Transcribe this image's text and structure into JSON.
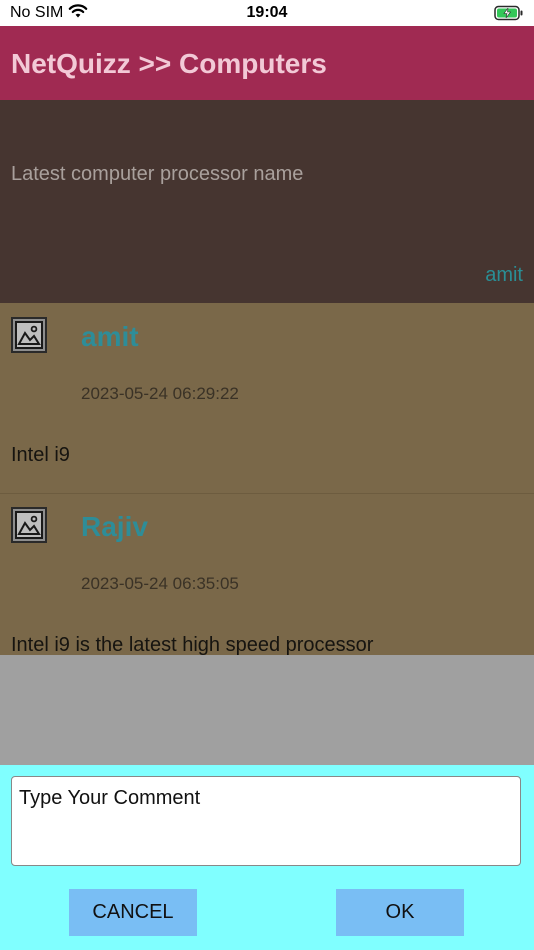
{
  "status_bar": {
    "carrier": "No SIM",
    "time": "19:04",
    "icons": [
      "wifi-icon",
      "battery-charging-icon"
    ]
  },
  "header": {
    "title": "NetQuizz >> Computers"
  },
  "question": {
    "text": "Latest computer processor name",
    "author": "amit"
  },
  "comments": [
    {
      "author": "amit",
      "timestamp": "2023-05-24 06:29:22",
      "text": "Intel i9",
      "avatar_icon": "image-placeholder-icon"
    },
    {
      "author": "Rajiv",
      "timestamp": "2023-05-24 06:35:05",
      "text": "Intel i9 is the latest high speed processor",
      "avatar_icon": "image-placeholder-icon"
    }
  ],
  "dialog": {
    "placeholder": "Type Your Comment",
    "value": "",
    "cancel_label": "CANCEL",
    "ok_label": "OK"
  },
  "colors": {
    "header_bg": "#a02a52",
    "question_bg": "#463530",
    "comments_bg": "#7a6849",
    "author_color": "#2e8d98",
    "dialog_bg": "#80ffff",
    "button_bg": "#79bef4"
  }
}
